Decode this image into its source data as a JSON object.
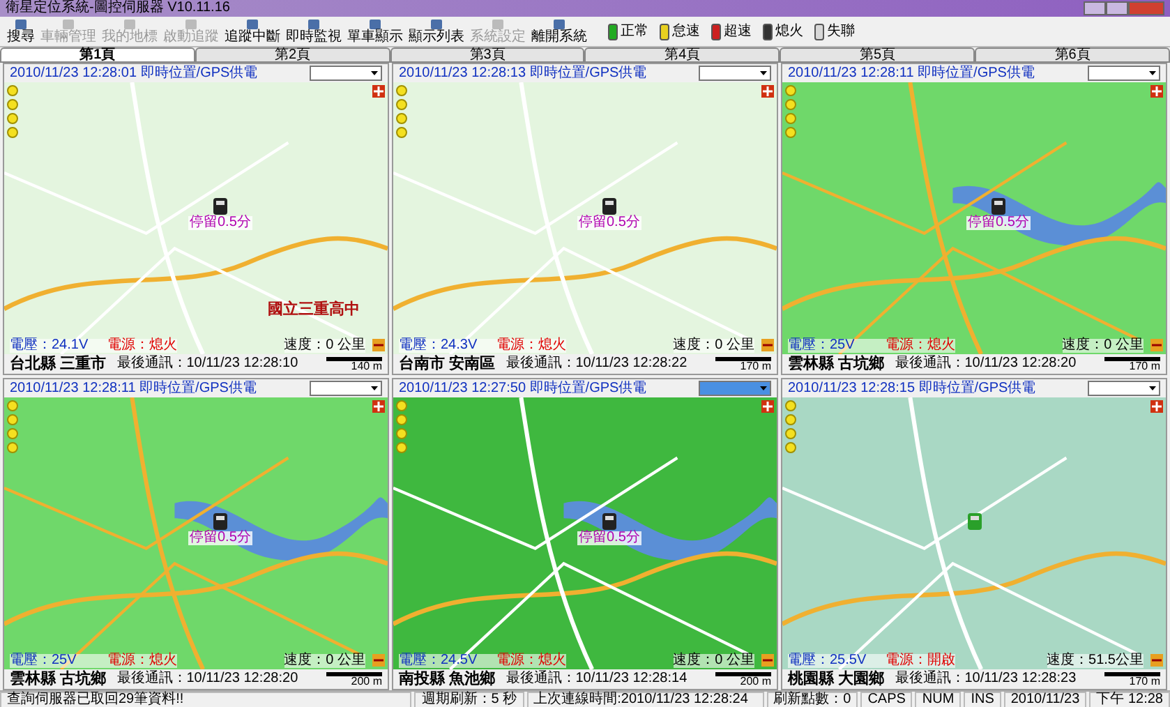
{
  "window": {
    "title": "衛星定位系統-圖控伺服器 V10.11.16"
  },
  "toolbar": [
    {
      "label": "搜尋",
      "disabled": false
    },
    {
      "label": "車輛管理",
      "disabled": true
    },
    {
      "label": "我的地標",
      "disabled": true
    },
    {
      "label": "啟動追蹤",
      "disabled": true
    },
    {
      "label": "追蹤中斷",
      "disabled": false
    },
    {
      "label": "即時監視",
      "disabled": false
    },
    {
      "label": "單車顯示",
      "disabled": false
    },
    {
      "label": "顯示列表",
      "disabled": false
    },
    {
      "label": "系統設定",
      "disabled": true
    },
    {
      "label": "離開系統",
      "disabled": false
    }
  ],
  "legend": [
    {
      "label": "正常",
      "color": "#22aa22"
    },
    {
      "label": "怠速",
      "color": "#e8d020"
    },
    {
      "label": "超速",
      "color": "#cc2020"
    },
    {
      "label": "熄火",
      "color": "#333333"
    },
    {
      "label": "失聯",
      "color": "#d8d8d8"
    }
  ],
  "tabs": [
    {
      "label": "第1頁",
      "selected": true
    },
    {
      "label": "第2頁",
      "selected": false
    },
    {
      "label": "第3頁",
      "selected": false
    },
    {
      "label": "第4頁",
      "selected": false
    },
    {
      "label": "第5頁",
      "selected": false
    },
    {
      "label": "第6頁",
      "selected": false
    }
  ],
  "panels": [
    {
      "header": "2010/11/23 12:28:01 即時位置/GPS供電",
      "dropdown_selected": false,
      "marker_label": "停留0.5分",
      "map_label": "國立三重高中",
      "voltage": "電壓：24.1V",
      "power": "電源：熄火",
      "speed": "速度：0 公里",
      "location": "台北縣 三重市",
      "last_contact": "最後通訊：10/11/23 12:28:10",
      "scale": "140 m"
    },
    {
      "header": "2010/11/23 12:28:13 即時位置/GPS供電",
      "dropdown_selected": false,
      "marker_label": "停留0.5分",
      "voltage": "電壓：24.3V",
      "power": "電源：熄火",
      "speed": "速度：0 公里",
      "location": "台南市 安南區",
      "last_contact": "最後通訊：10/11/23 12:28:22",
      "scale": "170 m"
    },
    {
      "header": "2010/11/23 12:28:11 即時位置/GPS供電",
      "dropdown_selected": false,
      "marker_label": "停留0.5分",
      "voltage": "電壓：25V",
      "power": "電源：熄火",
      "speed": "速度：0 公里",
      "location": "雲林縣 古坑鄉",
      "last_contact": "最後通訊：10/11/23 12:28:20",
      "scale": "170 m"
    },
    {
      "header": "2010/11/23 12:28:11 即時位置/GPS供電",
      "dropdown_selected": false,
      "marker_label": "停留0.5分",
      "voltage": "電壓：25V",
      "power": "電源：熄火",
      "speed": "速度：0 公里",
      "location": "雲林縣 古坑鄉",
      "last_contact": "最後通訊：10/11/23 12:28:20",
      "scale": "200 m"
    },
    {
      "header": "2010/11/23 12:27:50 即時位置/GPS供電",
      "dropdown_selected": true,
      "marker_label": "停留0.5分",
      "voltage": "電壓：24.5V",
      "power": "電源：熄火",
      "speed": "速度：0 公里",
      "location": "南投縣 魚池鄉",
      "last_contact": "最後通訊：10/11/23 12:28:14",
      "scale": "200 m"
    },
    {
      "header": "2010/11/23 12:28:15 即時位置/GPS供電",
      "dropdown_selected": false,
      "voltage": "電壓：25.5V",
      "power": "電源：開啟",
      "speed": "速度：51.5公里",
      "location": "桃園縣 大園鄉",
      "last_contact": "最後通訊：10/11/23 12:28:23",
      "scale": "170 m"
    }
  ],
  "status_bar": [
    "查詢伺服器已取回29筆資料!!",
    "週期刷新：5 秒",
    "上次連線時間:2010/11/23 12:28:24",
    "刷新點數：0",
    "CAPS",
    "NUM",
    "INS",
    "2010/11/23",
    "下午 12:28"
  ]
}
